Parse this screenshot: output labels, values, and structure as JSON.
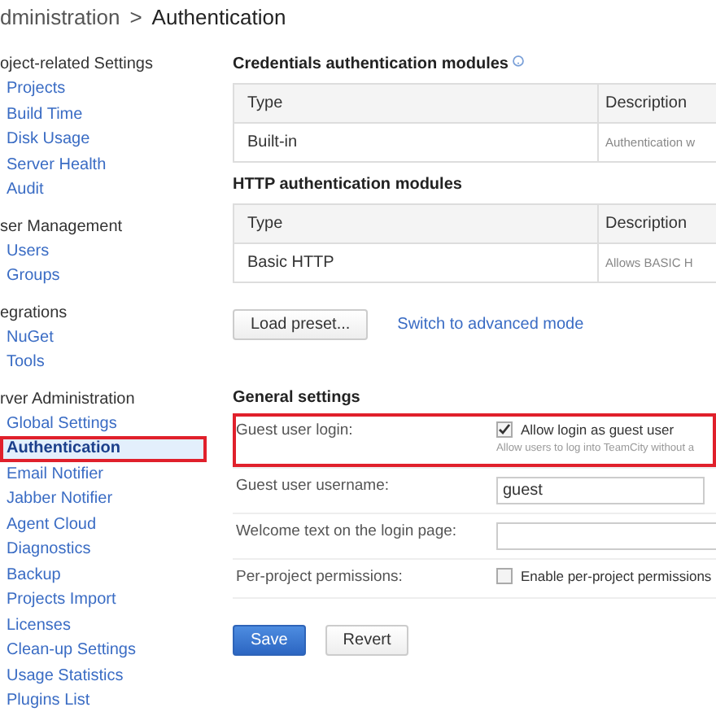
{
  "breadcrumb": {
    "parent": "dministration",
    "separator": ">",
    "current": "Authentication"
  },
  "sidebar": [
    {
      "heading": "oject-related Settings",
      "items": [
        {
          "label": "Projects",
          "selected": false
        },
        {
          "label": "Build Time",
          "selected": false
        },
        {
          "label": "Disk Usage",
          "selected": false
        },
        {
          "label": "Server Health",
          "selected": false
        },
        {
          "label": "Audit",
          "selected": false
        }
      ]
    },
    {
      "heading": "ser Management",
      "items": [
        {
          "label": "Users",
          "selected": false
        },
        {
          "label": "Groups",
          "selected": false
        }
      ]
    },
    {
      "heading": "egrations",
      "items": [
        {
          "label": "NuGet",
          "selected": false
        },
        {
          "label": "Tools",
          "selected": false
        }
      ]
    },
    {
      "heading": "rver Administration",
      "items": [
        {
          "label": "Global Settings",
          "selected": false
        },
        {
          "label": "Authentication",
          "selected": true
        },
        {
          "label": "Email Notifier",
          "selected": false
        },
        {
          "label": "Jabber Notifier",
          "selected": false
        },
        {
          "label": "Agent Cloud",
          "selected": false
        },
        {
          "label": "Diagnostics",
          "selected": false
        },
        {
          "label": "Backup",
          "selected": false
        },
        {
          "label": "Projects Import",
          "selected": false
        },
        {
          "label": "Licenses",
          "selected": false
        },
        {
          "label": "Clean-up Settings",
          "selected": false
        },
        {
          "label": "Usage Statistics",
          "selected": false
        },
        {
          "label": "Plugins List",
          "selected": false
        }
      ]
    }
  ],
  "modules": [
    {
      "title": "Credentials authentication modules",
      "help": true,
      "columns": [
        "Type",
        "Description"
      ],
      "rows": [
        [
          "Built-in",
          "Authentication w"
        ]
      ]
    },
    {
      "title": "HTTP authentication modules",
      "help": false,
      "columns": [
        "Type",
        "Description"
      ],
      "rows": [
        [
          "Basic HTTP",
          "Allows BASIC H"
        ]
      ]
    }
  ],
  "actions": {
    "load_preset": "Load preset...",
    "switch_link": "Switch to advanced mode"
  },
  "general": {
    "title": "General settings",
    "rows": [
      {
        "kind": "checkbox",
        "label": "Guest user login:",
        "option": "Allow login as guest user",
        "checked": true,
        "hint": "Allow users to log into TeamCity without a",
        "highlighted": true
      },
      {
        "kind": "text",
        "label": "Guest user username:",
        "value": "guest",
        "highlighted": false
      },
      {
        "kind": "text",
        "label": "Welcome text on the login page:",
        "value": "",
        "highlighted": false
      },
      {
        "kind": "checkbox",
        "label": "Per-project permissions:",
        "option": "Enable per-project permissions",
        "checked": false,
        "highlighted": false
      }
    ]
  },
  "buttons": {
    "save": "Save",
    "revert": "Revert"
  }
}
